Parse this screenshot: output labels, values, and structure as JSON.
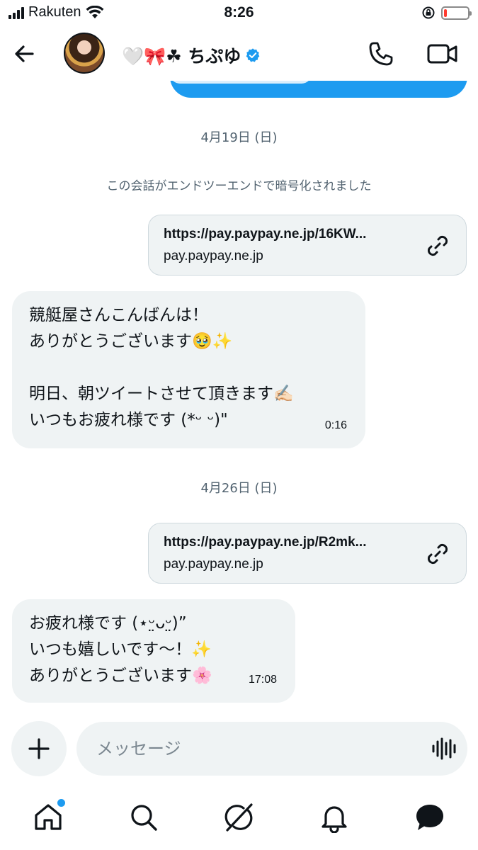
{
  "status_bar": {
    "carrier": "Rakuten",
    "time": "8:26",
    "battery_level": 0.12,
    "battery_color": "#ff3b30"
  },
  "header": {
    "contact_name": "🤍🎀☘ ちぷゆ",
    "back_icon": "arrow-left-icon",
    "verified_icon": "verified-badge-icon",
    "call_icon": "phone-icon",
    "video_icon": "video-camera-icon",
    "verified_color": "#1d9bf0"
  },
  "conversation": {
    "date_1": "4月19日 (日)",
    "e2e_notice": "この会話がエンドツーエンドで暗号化されました",
    "link_1": {
      "url": "https://pay.paypay.ne.jp/16KW...",
      "domain": "pay.paypay.ne.jp"
    },
    "message_1": {
      "lines": [
        "競艇屋さんこんばんは！",
        "ありがとうございます🥹✨",
        "",
        "明日、朝ツイートさせて頂きます✍🏻",
        "いつもお疲れ様です (*ᵕ ᵕ)\""
      ],
      "time": "0:16"
    },
    "date_2": "4月26日 (日)",
    "link_2": {
      "url": "https://pay.paypay.ne.jp/R2mk...",
      "domain": "pay.paypay.ne.jp"
    },
    "message_2": {
      "lines": [
        "お疲れ様です (⋆ᵕ̤ᴗᵕ̤)”",
        "いつも嬉しいです～！✨",
        "ありがとうございます🌸"
      ],
      "time": "17:08"
    }
  },
  "composer": {
    "placeholder": "メッセージ",
    "plus_icon": "plus-icon",
    "voice_icon": "voice-waveform-icon"
  },
  "bottom_nav": {
    "items": [
      "home-icon",
      "search-icon",
      "grok-icon",
      "notifications-icon",
      "messages-icon"
    ],
    "home_badge": true
  },
  "colors": {
    "accent": "#1d9bf0",
    "bubble_bg": "#eff3f4",
    "muted_text": "#536471"
  }
}
